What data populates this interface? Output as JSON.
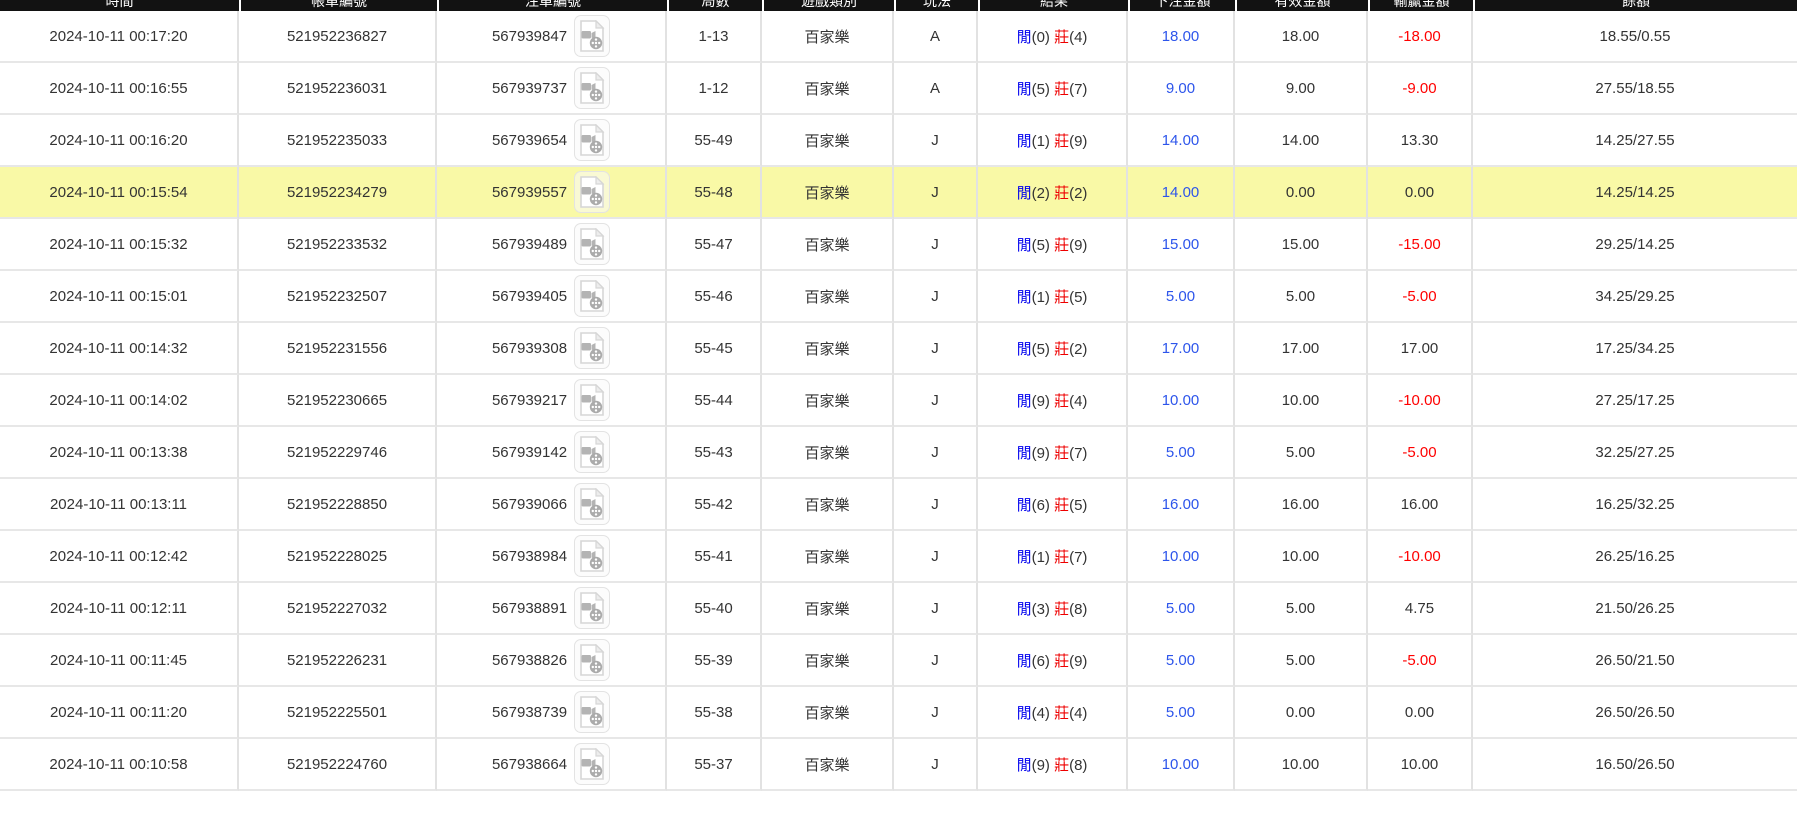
{
  "colors": {
    "header_bg": "#121212",
    "highlight_row": "#f9f9a6",
    "bet_link_blue": "#2d55eb",
    "player_blue": "#0000ee",
    "banker_red": "#ee0000",
    "loss_red": "#ff0000",
    "text": "#333333",
    "grid_line": "#e2e2e2"
  },
  "result_labels": {
    "player": "閒",
    "banker": "莊"
  },
  "icons": {
    "video_replay": "video-replay-icon"
  },
  "table": {
    "columns": [
      {
        "id": "time",
        "label": "時間"
      },
      {
        "id": "bill_no",
        "label": "帳單編號"
      },
      {
        "id": "game_no",
        "label": "注單編號"
      },
      {
        "id": "round",
        "label": "局數"
      },
      {
        "id": "game_type",
        "label": "遊戲類別"
      },
      {
        "id": "code",
        "label": "玩法"
      },
      {
        "id": "result",
        "label": "結果"
      },
      {
        "id": "bet",
        "label": "下注金額"
      },
      {
        "id": "valid",
        "label": "有效金額"
      },
      {
        "id": "winloss",
        "label": "輸贏金額"
      },
      {
        "id": "balance",
        "label": "餘額"
      }
    ],
    "rows": [
      {
        "time": "2024-10-11 00:17:20",
        "bill_no": "521952236827",
        "game_no": "567939847",
        "round": "1-13",
        "game_type": "百家樂",
        "code": "A",
        "player": 0,
        "banker": 4,
        "bet": "18.00",
        "valid": "18.00",
        "winloss": "-18.00",
        "balance": "18.55/0.55",
        "highlight": false
      },
      {
        "time": "2024-10-11 00:16:55",
        "bill_no": "521952236031",
        "game_no": "567939737",
        "round": "1-12",
        "game_type": "百家樂",
        "code": "A",
        "player": 5,
        "banker": 7,
        "bet": "9.00",
        "valid": "9.00",
        "winloss": "-9.00",
        "balance": "27.55/18.55",
        "highlight": false
      },
      {
        "time": "2024-10-11 00:16:20",
        "bill_no": "521952235033",
        "game_no": "567939654",
        "round": "55-49",
        "game_type": "百家樂",
        "code": "J",
        "player": 1,
        "banker": 9,
        "bet": "14.00",
        "valid": "14.00",
        "winloss": "13.30",
        "balance": "14.25/27.55",
        "highlight": false
      },
      {
        "time": "2024-10-11 00:15:54",
        "bill_no": "521952234279",
        "game_no": "567939557",
        "round": "55-48",
        "game_type": "百家樂",
        "code": "J",
        "player": 2,
        "banker": 2,
        "bet": "14.00",
        "valid": "0.00",
        "winloss": "0.00",
        "balance": "14.25/14.25",
        "highlight": true
      },
      {
        "time": "2024-10-11 00:15:32",
        "bill_no": "521952233532",
        "game_no": "567939489",
        "round": "55-47",
        "game_type": "百家樂",
        "code": "J",
        "player": 5,
        "banker": 9,
        "bet": "15.00",
        "valid": "15.00",
        "winloss": "-15.00",
        "balance": "29.25/14.25",
        "highlight": false
      },
      {
        "time": "2024-10-11 00:15:01",
        "bill_no": "521952232507",
        "game_no": "567939405",
        "round": "55-46",
        "game_type": "百家樂",
        "code": "J",
        "player": 1,
        "banker": 5,
        "bet": "5.00",
        "valid": "5.00",
        "winloss": "-5.00",
        "balance": "34.25/29.25",
        "highlight": false
      },
      {
        "time": "2024-10-11 00:14:32",
        "bill_no": "521952231556",
        "game_no": "567939308",
        "round": "55-45",
        "game_type": "百家樂",
        "code": "J",
        "player": 5,
        "banker": 2,
        "bet": "17.00",
        "valid": "17.00",
        "winloss": "17.00",
        "balance": "17.25/34.25",
        "highlight": false
      },
      {
        "time": "2024-10-11 00:14:02",
        "bill_no": "521952230665",
        "game_no": "567939217",
        "round": "55-44",
        "game_type": "百家樂",
        "code": "J",
        "player": 9,
        "banker": 4,
        "bet": "10.00",
        "valid": "10.00",
        "winloss": "-10.00",
        "balance": "27.25/17.25",
        "highlight": false
      },
      {
        "time": "2024-10-11 00:13:38",
        "bill_no": "521952229746",
        "game_no": "567939142",
        "round": "55-43",
        "game_type": "百家樂",
        "code": "J",
        "player": 9,
        "banker": 7,
        "bet": "5.00",
        "valid": "5.00",
        "winloss": "-5.00",
        "balance": "32.25/27.25",
        "highlight": false
      },
      {
        "time": "2024-10-11 00:13:11",
        "bill_no": "521952228850",
        "game_no": "567939066",
        "round": "55-42",
        "game_type": "百家樂",
        "code": "J",
        "player": 6,
        "banker": 5,
        "bet": "16.00",
        "valid": "16.00",
        "winloss": "16.00",
        "balance": "16.25/32.25",
        "highlight": false
      },
      {
        "time": "2024-10-11 00:12:42",
        "bill_no": "521952228025",
        "game_no": "567938984",
        "round": "55-41",
        "game_type": "百家樂",
        "code": "J",
        "player": 1,
        "banker": 7,
        "bet": "10.00",
        "valid": "10.00",
        "winloss": "-10.00",
        "balance": "26.25/16.25",
        "highlight": false
      },
      {
        "time": "2024-10-11 00:12:11",
        "bill_no": "521952227032",
        "game_no": "567938891",
        "round": "55-40",
        "game_type": "百家樂",
        "code": "J",
        "player": 3,
        "banker": 8,
        "bet": "5.00",
        "valid": "5.00",
        "winloss": "4.75",
        "balance": "21.50/26.25",
        "highlight": false
      },
      {
        "time": "2024-10-11 00:11:45",
        "bill_no": "521952226231",
        "game_no": "567938826",
        "round": "55-39",
        "game_type": "百家樂",
        "code": "J",
        "player": 6,
        "banker": 9,
        "bet": "5.00",
        "valid": "5.00",
        "winloss": "-5.00",
        "balance": "26.50/21.50",
        "highlight": false
      },
      {
        "time": "2024-10-11 00:11:20",
        "bill_no": "521952225501",
        "game_no": "567938739",
        "round": "55-38",
        "game_type": "百家樂",
        "code": "J",
        "player": 4,
        "banker": 4,
        "bet": "5.00",
        "valid": "0.00",
        "winloss": "0.00",
        "balance": "26.50/26.50",
        "highlight": false
      },
      {
        "time": "2024-10-11 00:10:58",
        "bill_no": "521952224760",
        "game_no": "567938664",
        "round": "55-37",
        "game_type": "百家樂",
        "code": "J",
        "player": 9,
        "banker": 8,
        "bet": "10.00",
        "valid": "10.00",
        "winloss": "10.00",
        "balance": "16.50/26.50",
        "highlight": false
      }
    ]
  }
}
